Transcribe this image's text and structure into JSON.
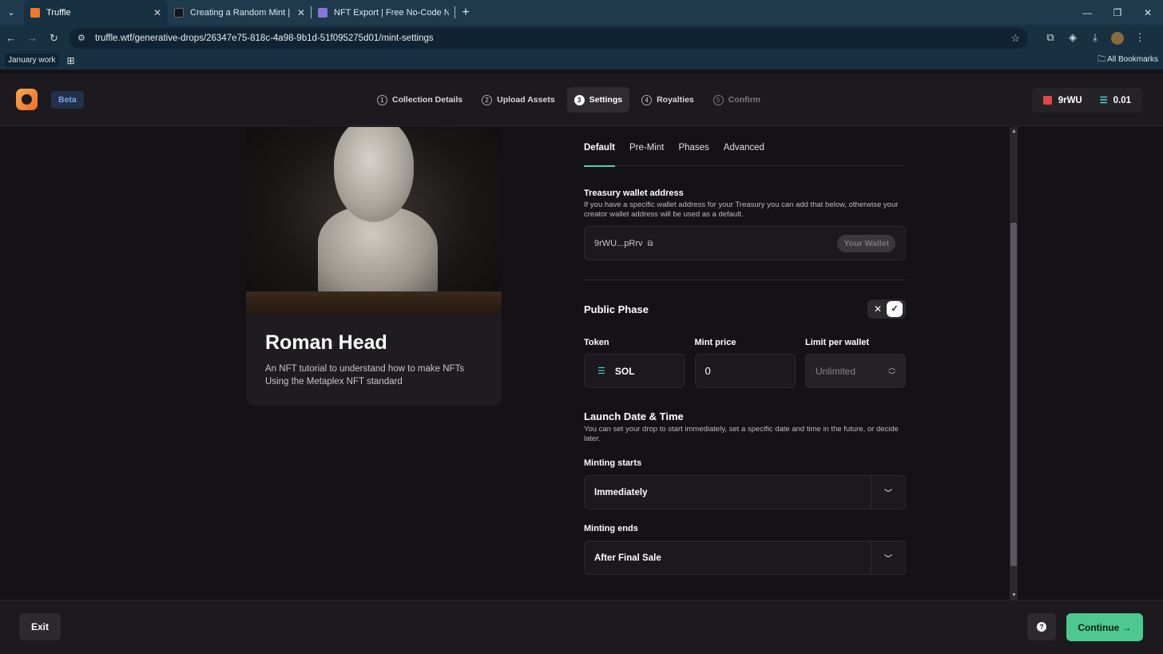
{
  "browser": {
    "tabs": [
      {
        "title": "Truffle",
        "active": true
      },
      {
        "title": "Creating a Random Mint | Truffl",
        "active": false
      },
      {
        "title": "NFT Export | Free No-Code NFT",
        "active": false
      }
    ],
    "url": "truffle.wtf/generative-drops/26347e75-818c-4a98-9b1d-51f095275d01/mint-settings",
    "bookmark_folder": "January work",
    "all_bookmarks": "All Bookmarks"
  },
  "header": {
    "beta": "Beta",
    "steps": [
      {
        "num": "1",
        "label": "Collection Details",
        "state": "done"
      },
      {
        "num": "2",
        "label": "Upload Assets",
        "state": "done"
      },
      {
        "num": "3",
        "label": "Settings",
        "state": "active"
      },
      {
        "num": "4",
        "label": "Royalties",
        "state": "todo"
      },
      {
        "num": "5",
        "label": "Confirm",
        "state": "disabled"
      }
    ],
    "wallet_name": "9rWU",
    "sol_balance": "0.01"
  },
  "card": {
    "title": "Roman Head",
    "description": "An NFT tutorial to understand how to make NFTs\nUsing the Metaplex NFT standard"
  },
  "form": {
    "tabs": [
      "Default",
      "Pre-Mint",
      "Phases",
      "Advanced"
    ],
    "treasury": {
      "label": "Treasury wallet address",
      "help": "If you have a specific wallet address for your Treasury you can add that below, otherwise your creator wallet address will be used as a default.",
      "address": "9rWU...pRrv",
      "your_wallet": "Your Wallet"
    },
    "public_phase": {
      "title": "Public Phase",
      "token_label": "Token",
      "token_value": "SOL",
      "price_label": "Mint price",
      "price_value": "0",
      "limit_label": "Limit per wallet",
      "limit_value": "Unlimited"
    },
    "launch": {
      "title": "Launch Date & Time",
      "help": "You can set your drop to start immediately, set a specific date and time in the future, or decide later.",
      "starts_label": "Minting starts",
      "starts_value": "Immediately",
      "ends_label": "Minting ends",
      "ends_value": "After Final Sale"
    }
  },
  "footer": {
    "exit": "Exit",
    "help": "?",
    "continue": "Continue →"
  }
}
